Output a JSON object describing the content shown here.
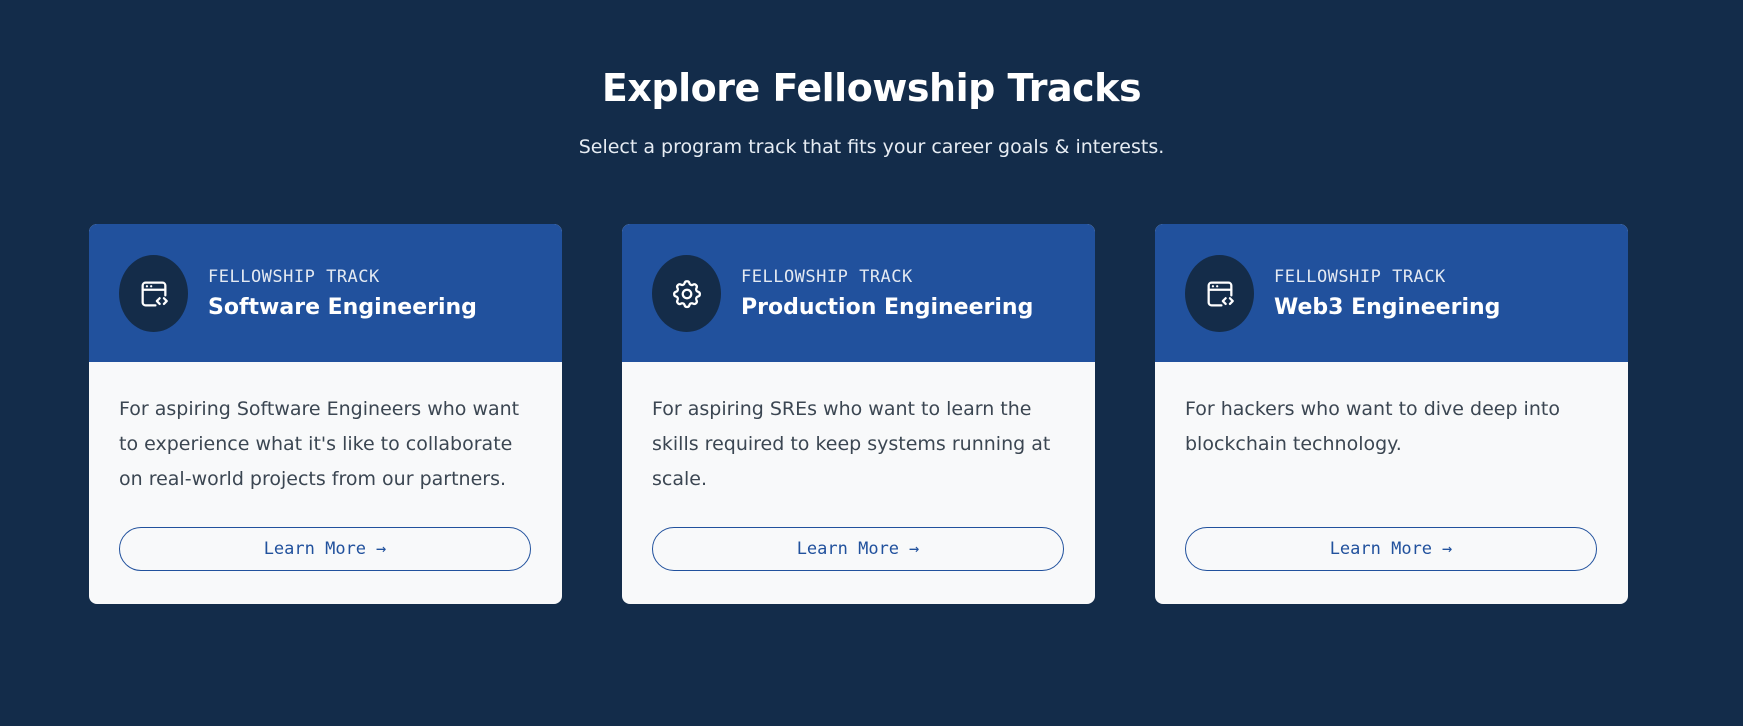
{
  "section": {
    "title": "Explore Fellowship Tracks",
    "subtitle": "Select a program track that fits your career goals & interests."
  },
  "cards": [
    {
      "kicker": "FELLOWSHIP TRACK",
      "title": "Software Engineering",
      "icon": "code-window-icon",
      "description": "For aspiring Software Engineers who want to experience what it's like to collaborate on real-world projects from our partners.",
      "button_label": "Learn More",
      "button_arrow": "→"
    },
    {
      "kicker": "FELLOWSHIP TRACK",
      "title": "Production Engineering",
      "icon": "gear-icon",
      "description": "For aspiring SREs who want to learn the skills required to keep systems running at scale.",
      "button_label": "Learn More",
      "button_arrow": "→"
    },
    {
      "kicker": "FELLOWSHIP TRACK",
      "title": "Web3 Engineering",
      "icon": "code-window-icon",
      "description": "For hackers who want to dive deep into blockchain technology.",
      "button_label": "Learn More",
      "button_arrow": "→"
    }
  ],
  "colors": {
    "page_background": "#132c4a",
    "card_header": "#21519d",
    "card_body": "#f8f9fa",
    "icon_circle": "#142c49",
    "button_accent": "#21519d",
    "body_text": "#3b4652"
  }
}
